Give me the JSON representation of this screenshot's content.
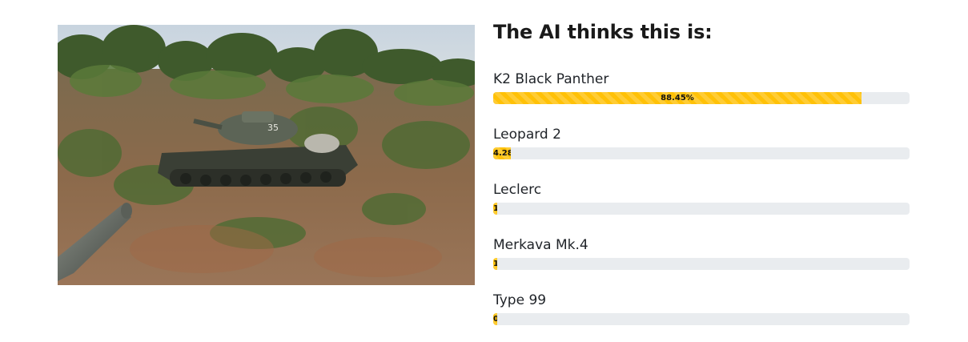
{
  "image": {
    "alt_subject": "tank"
  },
  "results": {
    "title": "The AI thinks this is:",
    "bar_color": "#ffc107",
    "track_color": "#e9ecef",
    "predictions": [
      {
        "label": "K2 Black Panther",
        "percent": 88.45,
        "bar_text": "88.45%"
      },
      {
        "label": "Leopard 2",
        "percent": 4.28,
        "bar_text": "4.28"
      },
      {
        "label": "Leclerc",
        "percent": 1,
        "bar_text": "1"
      },
      {
        "label": "Merkava Mk.4",
        "percent": 1,
        "bar_text": "1"
      },
      {
        "label": "Type 99",
        "percent": 0.5,
        "bar_text": "0"
      }
    ]
  }
}
